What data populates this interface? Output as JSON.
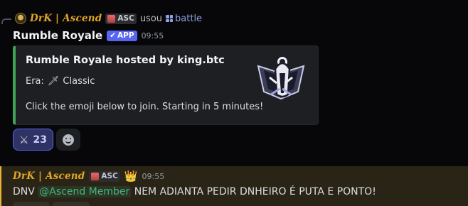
{
  "reply": {
    "author": "DrK | Ascend",
    "tag": "ASC",
    "text": "usou",
    "command": "battle"
  },
  "bot": {
    "name": "Rumble Royale",
    "badge": "APP",
    "timestamp": "09:55"
  },
  "embed": {
    "accent_color": "#3fa45b",
    "title": "Rumble Royale hosted by king.btc",
    "era_label": "Era:",
    "era_value": "Classic",
    "era_icon": "sword-icon",
    "description": "Click the emoji below to join. Starting in 5 minutes!"
  },
  "reactions": [
    {
      "emoji": "crossed-swords-icon",
      "count": "23"
    }
  ],
  "message2": {
    "author": "DrK | Ascend",
    "tag": "ASC",
    "badge_icon": "crown-icon",
    "timestamp": "09:55",
    "text_before": "DNV ",
    "mention": "@Ascend Member",
    "text_after": "  NEM ADIANTA PEDIR DNHEIRO É PUTA E PONTO!"
  },
  "colors": {
    "background": "#070709",
    "author_gold": "#e0a526",
    "app_badge": "#5865f2",
    "mention_highlight": "#2a2417",
    "role_mention": "#43b581"
  }
}
